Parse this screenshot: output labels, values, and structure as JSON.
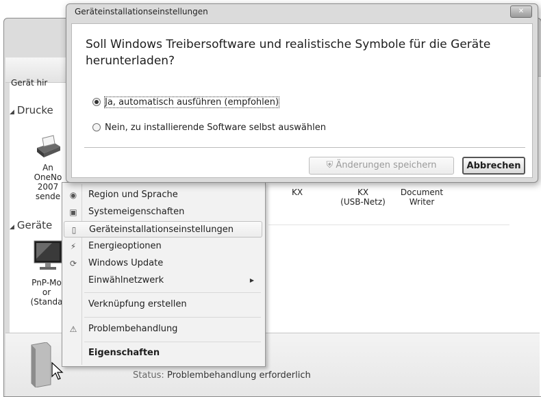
{
  "dialog": {
    "title": "Geräteinstallationseinstellungen",
    "question": "Soll Windows Treibersoftware und realistische Symbole für die Geräte herunterladen?",
    "options": [
      {
        "label": "Ja, automatisch ausführen (empfohlen)",
        "selected": true
      },
      {
        "label": "Nein, zu installierende Software selbst auswählen",
        "selected": false
      }
    ],
    "save_label": "Änderungen speichern",
    "cancel_label": "Abbrechen",
    "close_label": "✕"
  },
  "context_menu": {
    "items": [
      {
        "label": "Region und Sprache",
        "icon": "globe-icon"
      },
      {
        "label": "Systemeigenschaften",
        "icon": "computer-icon"
      },
      {
        "label": "Geräteinstallationseinstellungen",
        "icon": "device-icon"
      },
      {
        "label": "Energieoptionen",
        "icon": "battery-icon"
      },
      {
        "label": "Windows Update",
        "icon": "windows-update-icon"
      },
      {
        "label": "Einwählnetzwerk",
        "icon": ""
      },
      {
        "label": "Verknüpfung erstellen",
        "icon": ""
      },
      {
        "label": "Problembehandlung",
        "icon": "warning-icon"
      },
      {
        "label": "Eigenschaften",
        "icon": ""
      }
    ]
  },
  "explorer": {
    "toolbar_label": "Gerät hir",
    "section_printers": "Drucke",
    "section_devices": "Geräte",
    "printer_caption": [
      "An",
      "OneNo",
      "2007",
      "sende"
    ],
    "device_columns": [
      {
        "line1": "KX",
        "line2": ""
      },
      {
        "line1": "KX",
        "line2": "(USB-Netz)"
      },
      {
        "line1": "Document",
        "line2": "Writer"
      }
    ],
    "monitor_caption": [
      "PnP-Mo",
      "or",
      "(Standa"
    ],
    "status_label": "Status:",
    "status_value": "Problembehandlung erforderlich"
  }
}
